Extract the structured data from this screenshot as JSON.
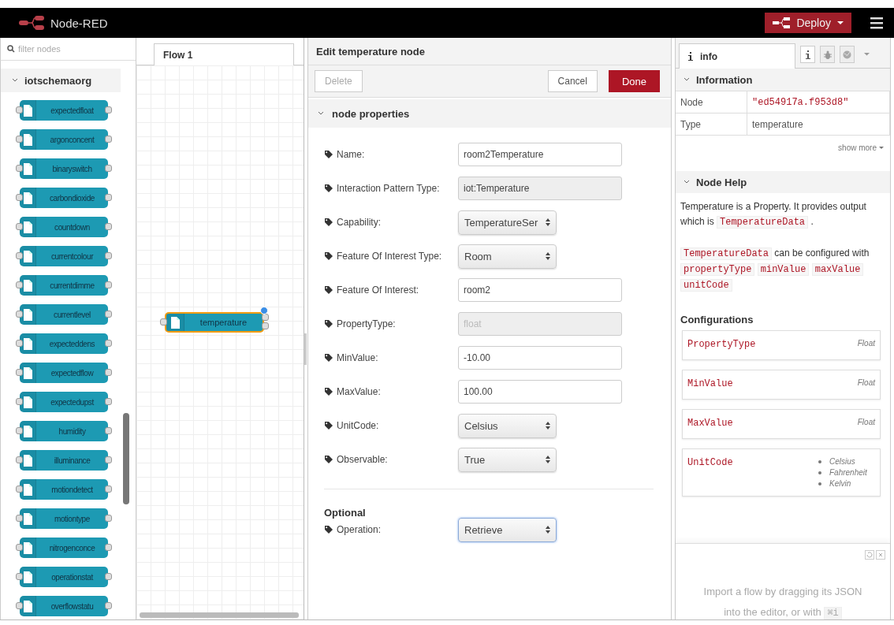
{
  "header": {
    "title": "Node-RED",
    "deploy": {
      "label": "Deploy"
    }
  },
  "palette": {
    "filter_placeholder": "filter nodes",
    "category": {
      "label": "iotschemaorg",
      "expanded": true
    },
    "nodes": [
      "expectedfloat",
      "argonconcent",
      "binaryswitch",
      "carbondioxide",
      "countdown",
      "currentcolour",
      "currentdimme",
      "currentlevel",
      "expecteddens",
      "expectedflow",
      "expectedupst",
      "humidity",
      "illuminance",
      "motiondetect",
      "motiontype",
      "nitrogenconce",
      "operationstat",
      "overflowstatu"
    ]
  },
  "canvas": {
    "tabs": [
      {
        "label": "Flow 1",
        "selected": true
      }
    ],
    "nodes": [
      {
        "label": "temperature",
        "selected": true,
        "changed": true
      }
    ]
  },
  "editor": {
    "title": "Edit temperature node",
    "buttons": [
      {
        "label": "Delete",
        "kind": "secondary",
        "disabled": true
      },
      {
        "label": "Cancel",
        "kind": "secondary",
        "disabled": false
      },
      {
        "label": "Done",
        "kind": "primary",
        "disabled": false
      }
    ],
    "section": {
      "label": "node properties",
      "expanded": true
    },
    "fields": [
      {
        "label": "Name:",
        "kind": "text",
        "value": "room2Temperature",
        "disabled": false
      },
      {
        "label": "Interaction Pattern Type:",
        "kind": "text",
        "value": "iot:Temperature",
        "disabled": true
      },
      {
        "label": "Capability:",
        "kind": "select",
        "value": "TemperatureSer",
        "focused": false
      },
      {
        "label": "Feature Of Interest Type:",
        "kind": "select",
        "value": "Room",
        "focused": false
      },
      {
        "label": "Feature Of Interest:",
        "kind": "text",
        "value": "room2",
        "disabled": false
      },
      {
        "label": "PropertyType:",
        "kind": "text",
        "placeholder": "float",
        "disabled": true
      },
      {
        "label": "MinValue:",
        "kind": "text",
        "value": "-10.00",
        "disabled": false
      },
      {
        "label": "MaxValue:",
        "kind": "text",
        "value": "100.00",
        "disabled": false
      },
      {
        "label": "UnitCode:",
        "kind": "select",
        "value": "Celsius",
        "focused": false
      },
      {
        "label": "Observable:",
        "kind": "select",
        "value": "True",
        "focused": false
      }
    ],
    "optional": {
      "title": "Optional",
      "fields": [
        {
          "label": "Operation:",
          "kind": "select",
          "value": "Retrieve",
          "focused": true
        }
      ]
    }
  },
  "sidebar": {
    "tabs": [
      {
        "label": "info",
        "selected": true
      }
    ],
    "tab_buttons": [
      {
        "kind": "info",
        "selected": true
      },
      {
        "kind": "debug",
        "selected": false
      },
      {
        "kind": "globe",
        "selected": false
      },
      {
        "kind": "menu",
        "selected": false
      }
    ],
    "information": {
      "label": "Information",
      "expanded": true,
      "rows": [
        {
          "key": "Node",
          "value": "\"ed54917a.f953d8\"",
          "kind": "string"
        },
        {
          "key": "Type",
          "value": "temperature",
          "kind": "text"
        }
      ],
      "show_more": "show more"
    },
    "help": {
      "label": "Node Help",
      "expanded": true,
      "paragraphs": [
        [
          {
            "kind": "text",
            "text": "Temperature is a Property. It provides output which is "
          },
          {
            "kind": "code",
            "text": "TemperatureData"
          },
          {
            "kind": "text",
            "text": " ."
          }
        ],
        [
          {
            "kind": "code",
            "text": "TemperatureData"
          },
          {
            "kind": "text",
            "text": " can be configured with "
          },
          {
            "kind": "code",
            "text": "propertyType"
          },
          {
            "kind": "code",
            "text": "minValue"
          },
          {
            "kind": "code",
            "text": "maxValue"
          },
          {
            "kind": "code",
            "text": "unitCode"
          }
        ]
      ]
    },
    "configurations": {
      "title": "Configurations",
      "items": [
        {
          "name": "PropertyType",
          "type": "Float"
        },
        {
          "name": "MinValue",
          "type": "Float"
        },
        {
          "name": "MaxValue",
          "type": "Float"
        },
        {
          "name": "UnitCode",
          "options": [
            "Celsius",
            "Fahrenheit",
            "Kelvin"
          ]
        }
      ]
    },
    "import_hint": [
      {
        "kind": "text",
        "text": "Import a flow by dragging its JSON into the editor, or with "
      },
      {
        "kind": "code",
        "text": "⌘i"
      }
    ]
  }
}
